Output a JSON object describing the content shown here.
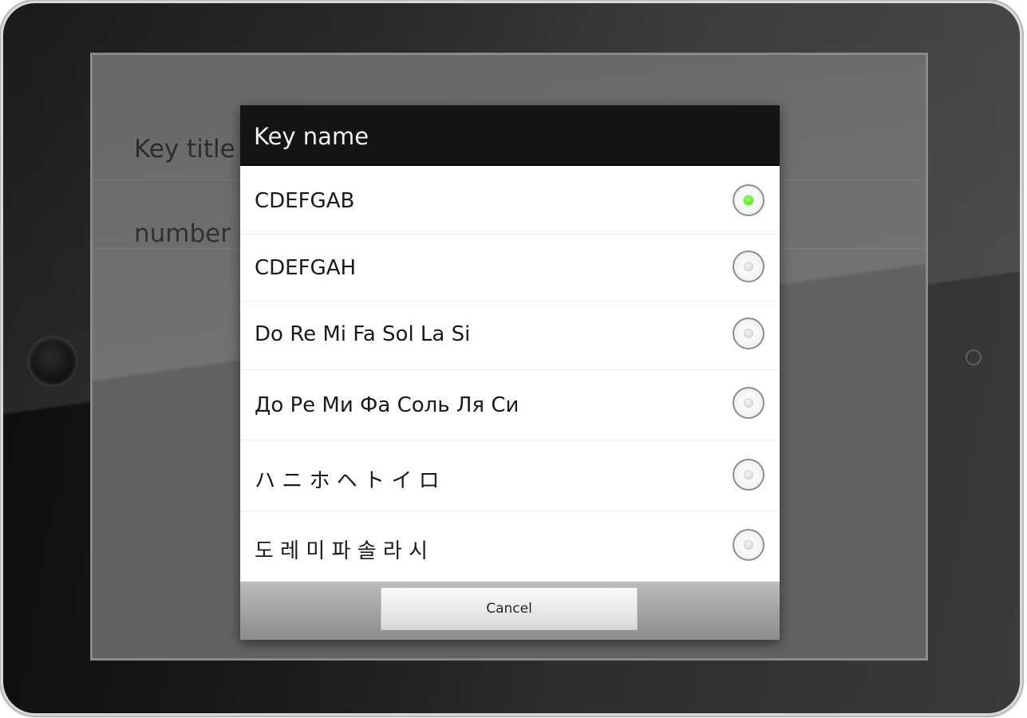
{
  "background_prefs": {
    "key_title_label": "Key title",
    "number_label": "number o"
  },
  "dialog": {
    "title": "Key name",
    "selected_index": 0,
    "options": [
      {
        "label": "CDEFGAB",
        "checked": true
      },
      {
        "label": "CDEFGAH",
        "checked": false
      },
      {
        "label": "Do Re Mi Fa Sol La Si",
        "checked": false
      },
      {
        "label": "До Ре Ми Фа Соль Ля Си",
        "checked": false
      },
      {
        "label": "ハ ニ ホ ヘ ト イ ロ",
        "checked": false
      },
      {
        "label": "도 레 미 파 솔 라 시",
        "checked": false
      }
    ],
    "cancel_label": "Cancel"
  },
  "colors": {
    "accent_checked": "#3fd600",
    "dialog_title_bg": "#141414",
    "screen_dim": "#5f5f5f"
  }
}
